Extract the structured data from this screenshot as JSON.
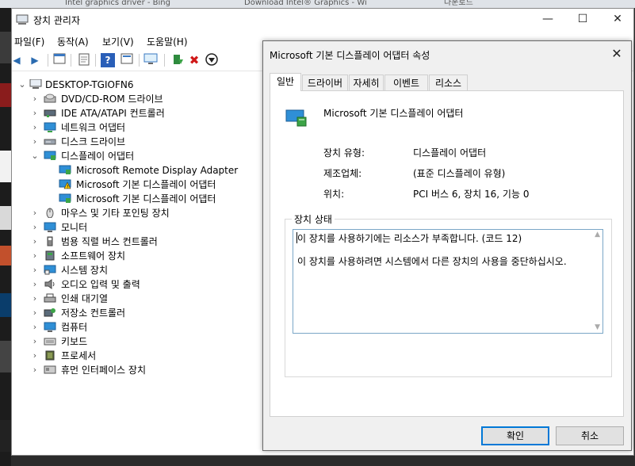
{
  "background_tabs": [
    {
      "label": "Intel graphics driver - Bing"
    },
    {
      "label": "Download Intel® Graphics - Wi"
    },
    {
      "label": "다운로드"
    }
  ],
  "device_manager": {
    "title": "장치 관리자",
    "menu": [
      "파일(F)",
      "동작(A)",
      "보기(V)",
      "도움말(H)"
    ],
    "toolbar_icons": [
      "back-icon",
      "forward-icon",
      "properties-icon",
      "help-icon",
      "scan-hardware-icon",
      "update-driver-icon",
      "uninstall-icon",
      "disable-icon"
    ],
    "tree": {
      "root": "DESKTOP-TGIOFN6",
      "items": [
        {
          "label": "DVD/CD-ROM 드라이브",
          "expanded": false
        },
        {
          "label": "IDE ATA/ATAPI 컨트롤러",
          "expanded": false
        },
        {
          "label": "네트워크 어댑터",
          "expanded": false
        },
        {
          "label": "디스크 드라이브",
          "expanded": false
        },
        {
          "label": "디스플레이 어댑터",
          "expanded": true,
          "children": [
            {
              "label": "Microsoft Remote Display Adapter",
              "warning": false
            },
            {
              "label": "Microsoft 기본 디스플레이 어댑터",
              "warning": true
            },
            {
              "label": "Microsoft 기본 디스플레이 어댑터",
              "warning": false
            }
          ]
        },
        {
          "label": "마우스 및 기타 포인팅 장치",
          "expanded": false
        },
        {
          "label": "모니터",
          "expanded": false
        },
        {
          "label": "범용 직렬 버스 컨트롤러",
          "expanded": false
        },
        {
          "label": "소프트웨어 장치",
          "expanded": false
        },
        {
          "label": "시스템 장치",
          "expanded": false
        },
        {
          "label": "오디오 입력 및 출력",
          "expanded": false
        },
        {
          "label": "인쇄 대기열",
          "expanded": false
        },
        {
          "label": "저장소 컨트롤러",
          "expanded": false
        },
        {
          "label": "컴퓨터",
          "expanded": false
        },
        {
          "label": "키보드",
          "expanded": false
        },
        {
          "label": "프로세서",
          "expanded": false
        },
        {
          "label": "휴먼 인터페이스 장치",
          "expanded": false
        }
      ]
    }
  },
  "dialog": {
    "title": "Microsoft 기본 디스플레이 어댑터 속성",
    "tabs": [
      "일반",
      "드라이버",
      "자세히",
      "이벤트",
      "리소스"
    ],
    "active_tab": "일반",
    "device_name": "Microsoft 기본 디스플레이 어댑터",
    "props": [
      {
        "label": "장치 유형:",
        "value": "디스플레이 어댑터"
      },
      {
        "label": "제조업체:",
        "value": "(표준 디스플레이 유형)"
      },
      {
        "label": "위치:",
        "value": "PCI 버스 6, 장치 16, 기능 0"
      }
    ],
    "status_group_title": "장치 상태",
    "status_line1": "이 장치를 사용하기에는 리소스가 부족합니다. (코드 12)",
    "status_line2": "이 장치를 사용하려면 시스템에서 다른 장치의 사용을 중단하십시오.",
    "ok_label": "확인",
    "cancel_label": "취소"
  },
  "colors": {
    "accent": "#0078d7",
    "warning": "#f2c200",
    "monitor": "#2f8fd6"
  }
}
